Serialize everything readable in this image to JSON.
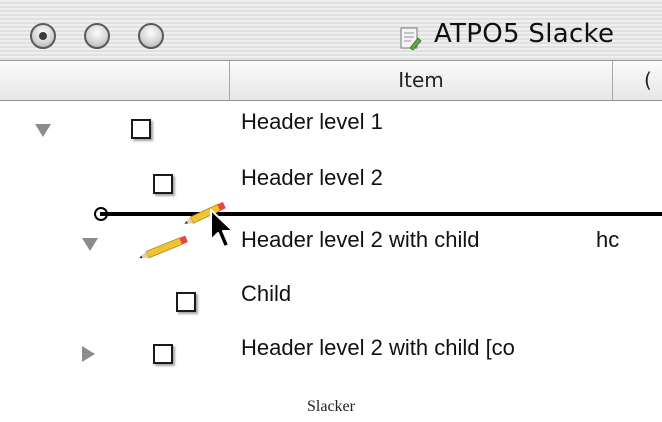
{
  "window": {
    "title": "ATPO5 Slacke",
    "title_icon": "document-icon",
    "buttons": [
      "close-button",
      "minimize-button",
      "zoom-button"
    ]
  },
  "columns": {
    "item": "Item",
    "next": "("
  },
  "rows": [
    {
      "label": "Header level 1",
      "expanded": true
    },
    {
      "label": "Header level 2"
    },
    {
      "label": "Header level 2 with child",
      "extra": "hc",
      "expanded": true
    },
    {
      "label": "Child"
    },
    {
      "label": "Header level 2 with child [co",
      "expanded": false
    }
  ],
  "drag": {
    "icons": [
      "pencil-icon",
      "arrow-cursor-icon"
    ]
  },
  "caption": "Slacker"
}
